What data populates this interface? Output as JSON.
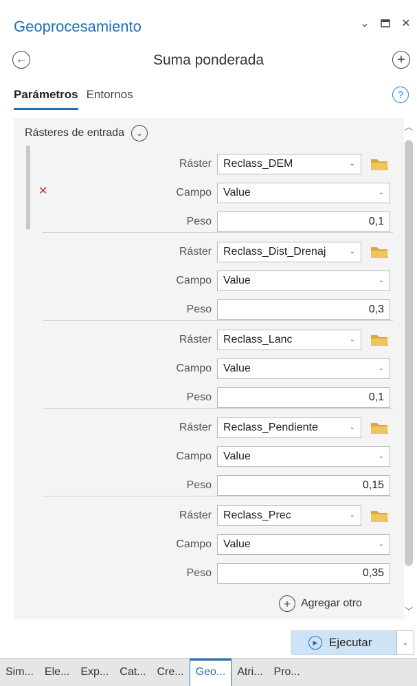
{
  "pane": {
    "title": "Geoprocesamiento",
    "tool_title": "Suma ponderada"
  },
  "tabs": [
    {
      "label": "Parámetros",
      "active": true
    },
    {
      "label": "Entornos",
      "active": false
    }
  ],
  "group": {
    "label": "Rásteres de entrada"
  },
  "labels": {
    "raster": "Ráster",
    "campo": "Campo",
    "peso": "Peso"
  },
  "rows": [
    {
      "raster": "Reclass_DEM",
      "campo": "Value",
      "peso": "0,1"
    },
    {
      "raster": "Reclass_Dist_Drenaj",
      "campo": "Value",
      "peso": "0,3"
    },
    {
      "raster": "Reclass_Lanc",
      "campo": "Value",
      "peso": "0,1"
    },
    {
      "raster": "Reclass_Pendiente",
      "campo": "Value",
      "peso": "0,15"
    },
    {
      "raster": "Reclass_Prec",
      "campo": "Value",
      "peso": "0,35"
    }
  ],
  "add_other": "Agregar otro",
  "run_button": "Ejecutar",
  "bottom_tabs": [
    "Sim...",
    "Ele...",
    "Exp...",
    "Cat...",
    "Cre...",
    "Geo...",
    "Atri...",
    "Pro..."
  ],
  "colors": {
    "accent": "#1e6fb5",
    "remove": "#c0392b",
    "folder": "#e8b84a",
    "run_bg": "#cfe3f6"
  }
}
